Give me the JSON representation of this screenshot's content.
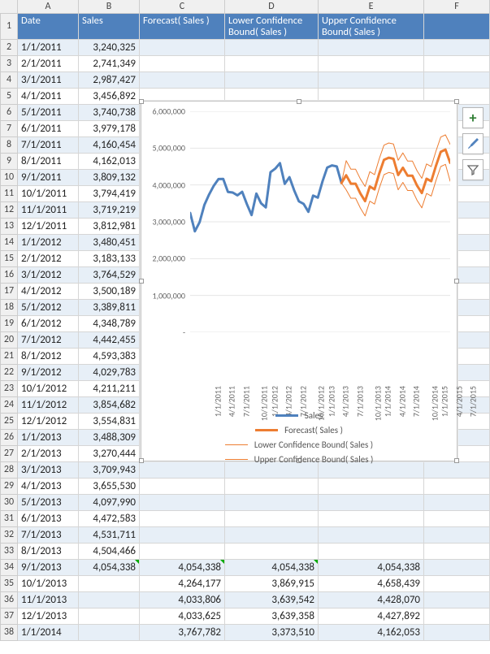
{
  "columns": [
    "A",
    "B",
    "C",
    "D",
    "E",
    "F"
  ],
  "headers": {
    "A": "Date",
    "B": "Sales",
    "C": "Forecast( Sales )",
    "D": "Lower Confidence Bound( Sales )",
    "E": "Upper Confidence Bound( Sales )",
    "F": ""
  },
  "rows": [
    {
      "n": 2,
      "date": "1/1/2011",
      "sales": "3,240,325"
    },
    {
      "n": 3,
      "date": "2/1/2011",
      "sales": "2,741,349"
    },
    {
      "n": 4,
      "date": "3/1/2011",
      "sales": "2,987,427"
    },
    {
      "n": 5,
      "date": "4/1/2011",
      "sales": "3,456,892"
    },
    {
      "n": 6,
      "date": "5/1/2011",
      "sales": "3,740,738"
    },
    {
      "n": 7,
      "date": "6/1/2011",
      "sales": "3,979,178"
    },
    {
      "n": 8,
      "date": "7/1/2011",
      "sales": "4,160,454"
    },
    {
      "n": 9,
      "date": "8/1/2011",
      "sales": "4,162,013"
    },
    {
      "n": 10,
      "date": "9/1/2011",
      "sales": "3,809,132"
    },
    {
      "n": 11,
      "date": "10/1/2011",
      "sales": "3,794,419"
    },
    {
      "n": 12,
      "date": "11/1/2011",
      "sales": "3,719,219"
    },
    {
      "n": 13,
      "date": "12/1/2011",
      "sales": "3,812,981"
    },
    {
      "n": 14,
      "date": "1/1/2012",
      "sales": "3,480,451"
    },
    {
      "n": 15,
      "date": "2/1/2012",
      "sales": "3,183,133"
    },
    {
      "n": 16,
      "date": "3/1/2012",
      "sales": "3,764,529"
    },
    {
      "n": 17,
      "date": "4/1/2012",
      "sales": "3,500,189"
    },
    {
      "n": 18,
      "date": "5/1/2012",
      "sales": "3,389,811"
    },
    {
      "n": 19,
      "date": "6/1/2012",
      "sales": "4,348,789"
    },
    {
      "n": 20,
      "date": "7/1/2012",
      "sales": "4,442,455"
    },
    {
      "n": 21,
      "date": "8/1/2012",
      "sales": "4,593,383"
    },
    {
      "n": 22,
      "date": "9/1/2012",
      "sales": "4,029,783"
    },
    {
      "n": 23,
      "date": "10/1/2012",
      "sales": "4,211,211"
    },
    {
      "n": 24,
      "date": "11/1/2012",
      "sales": "3,854,682"
    },
    {
      "n": 25,
      "date": "12/1/2012",
      "sales": "3,554,831"
    },
    {
      "n": 26,
      "date": "1/1/2013",
      "sales": "3,488,309"
    },
    {
      "n": 27,
      "date": "2/1/2013",
      "sales": "3,270,444"
    },
    {
      "n": 28,
      "date": "3/1/2013",
      "sales": "3,709,943"
    },
    {
      "n": 29,
      "date": "4/1/2013",
      "sales": "3,655,530"
    },
    {
      "n": 30,
      "date": "5/1/2013",
      "sales": "4,097,990"
    },
    {
      "n": 31,
      "date": "6/1/2013",
      "sales": "4,472,583"
    },
    {
      "n": 32,
      "date": "7/1/2013",
      "sales": "4,531,711"
    },
    {
      "n": 33,
      "date": "8/1/2013",
      "sales": "4,504,466"
    },
    {
      "n": 34,
      "date": "9/1/2013",
      "sales": "4,054,338",
      "forecast": "4,054,338",
      "lower": "4,054,338",
      "upper": "4,054,338",
      "tri": true
    },
    {
      "n": 35,
      "date": "10/1/2013",
      "forecast": "4,264,177",
      "lower": "3,869,915",
      "upper": "4,658,439"
    },
    {
      "n": 36,
      "date": "11/1/2013",
      "forecast": "4,033,806",
      "lower": "3,639,542",
      "upper": "4,428,070"
    },
    {
      "n": 37,
      "date": "12/1/2013",
      "forecast": "4,033,625",
      "lower": "3,639,358",
      "upper": "4,427,892"
    },
    {
      "n": 38,
      "date": "1/1/2014",
      "forecast": "3,767,782",
      "lower": "3,373,510",
      "upper": "4,162,053"
    }
  ],
  "chart_data": {
    "type": "line",
    "x": [
      "1/1/2011",
      "2/1/2011",
      "3/1/2011",
      "4/1/2011",
      "5/1/2011",
      "6/1/2011",
      "7/1/2011",
      "8/1/2011",
      "9/1/2011",
      "10/1/2011",
      "11/1/2011",
      "12/1/2011",
      "1/1/2012",
      "2/1/2012",
      "3/1/2012",
      "4/1/2012",
      "5/1/2012",
      "6/1/2012",
      "7/1/2012",
      "8/1/2012",
      "9/1/2012",
      "10/1/2012",
      "11/1/2012",
      "12/1/2012",
      "1/1/2013",
      "2/1/2013",
      "3/1/2013",
      "4/1/2013",
      "5/1/2013",
      "6/1/2013",
      "7/1/2013",
      "8/1/2013",
      "9/1/2013",
      "10/1/2013",
      "11/1/2013",
      "12/1/2013",
      "1/1/2014",
      "2/1/2014",
      "3/1/2014",
      "4/1/2014",
      "5/1/2014",
      "6/1/2014",
      "7/1/2014",
      "8/1/2014",
      "9/1/2014",
      "10/1/2014",
      "11/1/2014",
      "12/1/2014",
      "1/1/2015",
      "2/1/2015",
      "3/1/2015",
      "4/1/2015",
      "5/1/2015",
      "6/1/2015",
      "7/1/2015",
      "8/1/2015"
    ],
    "x_ticks": [
      "1/1/2011",
      "4/1/2011",
      "7/1/2011",
      "10/1/2011",
      "1/1/2012",
      "4/1/2012",
      "7/1/2012",
      "10/1/2012",
      "1/1/2013",
      "4/1/2013",
      "7/1/2013",
      "10/1/2013",
      "1/1/2014",
      "4/1/2014",
      "7/1/2014",
      "10/1/2014",
      "1/1/2015",
      "4/1/2015",
      "7/1/2015"
    ],
    "series": [
      {
        "name": "Sales",
        "color": "#4f81bd",
        "width": 3,
        "values": [
          3240325,
          2741349,
          2987427,
          3456892,
          3740738,
          3979178,
          4160454,
          4162013,
          3809132,
          3794419,
          3719219,
          3812981,
          3480451,
          3183133,
          3764529,
          3500189,
          3389811,
          4348789,
          4442455,
          4593383,
          4029783,
          4211211,
          3854682,
          3554831,
          3488309,
          3270444,
          3709943,
          3655530,
          4097990,
          4472583,
          4531711,
          4504466,
          4054338,
          null,
          null,
          null,
          null,
          null,
          null,
          null,
          null,
          null,
          null,
          null,
          null,
          null,
          null,
          null,
          null,
          null,
          null,
          null,
          null,
          null,
          null,
          null
        ]
      },
      {
        "name": "Forecast( Sales )",
        "color": "#ed7d31",
        "width": 3,
        "values": [
          null,
          null,
          null,
          null,
          null,
          null,
          null,
          null,
          null,
          null,
          null,
          null,
          null,
          null,
          null,
          null,
          null,
          null,
          null,
          null,
          null,
          null,
          null,
          null,
          null,
          null,
          null,
          null,
          null,
          null,
          null,
          null,
          4054338,
          4264177,
          4033806,
          4033625,
          3767782,
          3560000,
          3960000,
          3880000,
          4310000,
          4680000,
          4740000,
          4710000,
          4270000,
          4470000,
          4250000,
          4250000,
          3980000,
          3780000,
          4170000,
          4100000,
          4520000,
          4900000,
          4960000,
          4600000
        ]
      },
      {
        "name": "Lower Confidence Bound( Sales )",
        "color": "#ed7d31",
        "width": 1,
        "values": [
          null,
          null,
          null,
          null,
          null,
          null,
          null,
          null,
          null,
          null,
          null,
          null,
          null,
          null,
          null,
          null,
          null,
          null,
          null,
          null,
          null,
          null,
          null,
          null,
          null,
          null,
          null,
          null,
          null,
          null,
          null,
          null,
          4054338,
          3869915,
          3639542,
          3639358,
          3373510,
          3160000,
          3560000,
          3480000,
          3910000,
          4280000,
          4340000,
          4310000,
          3870000,
          4070000,
          3850000,
          3850000,
          3580000,
          3380000,
          3770000,
          3700000,
          4120000,
          4500000,
          4560000,
          4100000
        ]
      },
      {
        "name": "Upper Confidence Bound( Sales )",
        "color": "#ed7d31",
        "width": 1,
        "values": [
          null,
          null,
          null,
          null,
          null,
          null,
          null,
          null,
          null,
          null,
          null,
          null,
          null,
          null,
          null,
          null,
          null,
          null,
          null,
          null,
          null,
          null,
          null,
          null,
          null,
          null,
          null,
          null,
          null,
          null,
          null,
          null,
          4054338,
          4658439,
          4428070,
          4427892,
          4162053,
          3960000,
          4360000,
          4280000,
          4710000,
          5080000,
          5140000,
          5110000,
          4670000,
          4870000,
          4650000,
          4650000,
          4380000,
          4180000,
          4570000,
          4500000,
          4920000,
          5300000,
          5360000,
          5100000
        ]
      }
    ],
    "ylim": [
      0,
      6000000
    ],
    "yticks": [
      0,
      1000000,
      2000000,
      3000000,
      4000000,
      5000000,
      6000000
    ],
    "yticklabels": [
      "-",
      "1,000,000",
      "2,000,000",
      "3,000,000",
      "4,000,000",
      "5,000,000",
      "6,000,000"
    ],
    "legend": [
      "Sales",
      "Forecast( Sales )",
      "Lower Confidence Bound( Sales )",
      "Upper Confidence Bound( Sales )"
    ]
  }
}
